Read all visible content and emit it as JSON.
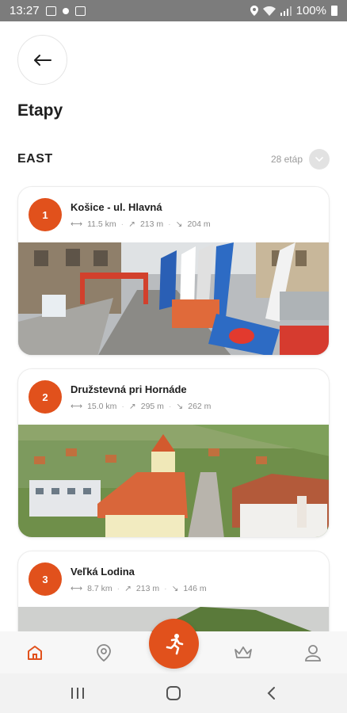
{
  "status_bar": {
    "time": "13:27",
    "battery": "100%"
  },
  "header": {
    "title": "Etapy"
  },
  "section": {
    "title": "EAST",
    "count": "28 etáp"
  },
  "stages": [
    {
      "number": "1",
      "name": "Košice - ul. Hlavná",
      "distance": "11.5 km",
      "ascent": "213 m",
      "descent": "204 m"
    },
    {
      "number": "2",
      "name": "Družstevná pri Hornáde",
      "distance": "15.0 km",
      "ascent": "295 m",
      "descent": "262 m"
    },
    {
      "number": "3",
      "name": "Veľká Lodina",
      "distance": "8.7 km",
      "ascent": "213 m",
      "descent": "146 m"
    }
  ],
  "colors": {
    "accent": "#e1511c",
    "status_bar": "#7c7c7c",
    "nav_icon": "#8a8a8a"
  },
  "bottom_nav": {
    "items": [
      "home-icon",
      "map-pin-icon",
      "runner-icon",
      "crown-icon",
      "user-icon"
    ],
    "active": "home-icon"
  }
}
